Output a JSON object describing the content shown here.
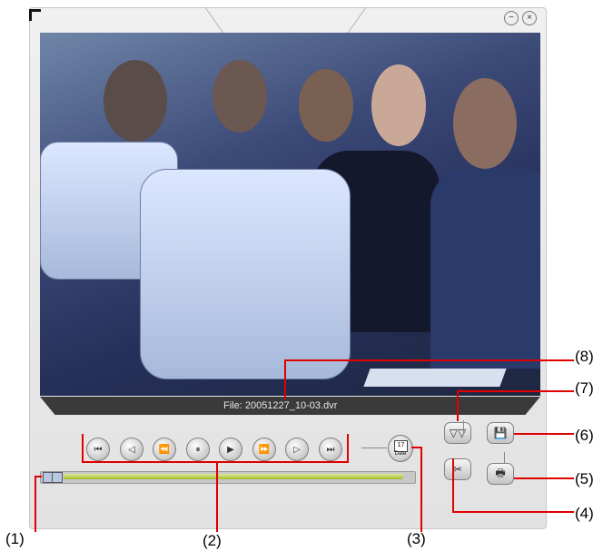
{
  "window": {
    "minimize_icon": "minimize-icon",
    "close_icon": "close-icon"
  },
  "video": {
    "file_caption": "File: 20051227_10-03.dvr"
  },
  "playback_controls": [
    {
      "name": "skip-to-start-button",
      "icon": "skip-start-icon",
      "glyph": "⏮"
    },
    {
      "name": "step-back-button",
      "icon": "step-back-icon",
      "glyph": "◁"
    },
    {
      "name": "rewind-button",
      "icon": "rewind-icon",
      "glyph": "⏪"
    },
    {
      "name": "pause-button",
      "icon": "pause-icon",
      "glyph": "⏸"
    },
    {
      "name": "play-button",
      "icon": "play-icon",
      "glyph": "▶"
    },
    {
      "name": "fast-forward-button",
      "icon": "fast-forward-icon",
      "glyph": "⏩"
    },
    {
      "name": "step-forward-button",
      "icon": "step-forward-icon",
      "glyph": "▷"
    },
    {
      "name": "skip-to-end-button",
      "icon": "skip-end-icon",
      "glyph": "⏭"
    }
  ],
  "date_button": {
    "day": "17",
    "label": "Date"
  },
  "progress": {
    "fraction": 0.98
  },
  "function_buttons": [
    {
      "name": "filter-button",
      "icon": "filter-icon",
      "glyph": "▽▽"
    },
    {
      "name": "save-button",
      "icon": "save-icon",
      "glyph": "💾"
    },
    {
      "name": "cut-button",
      "icon": "scissors-icon",
      "glyph": "✂"
    },
    {
      "name": "print-button",
      "icon": "printer-icon",
      "glyph": "🖶"
    }
  ],
  "callouts": {
    "c1": "(1)",
    "c2": "(2)",
    "c3": "(3)",
    "c4": "(4)",
    "c5": "(5)",
    "c6": "(6)",
    "c7": "(7)",
    "c8": "(8)"
  },
  "colors": {
    "callout_line": "#e00000",
    "progress_fill": "#9fbe28"
  }
}
